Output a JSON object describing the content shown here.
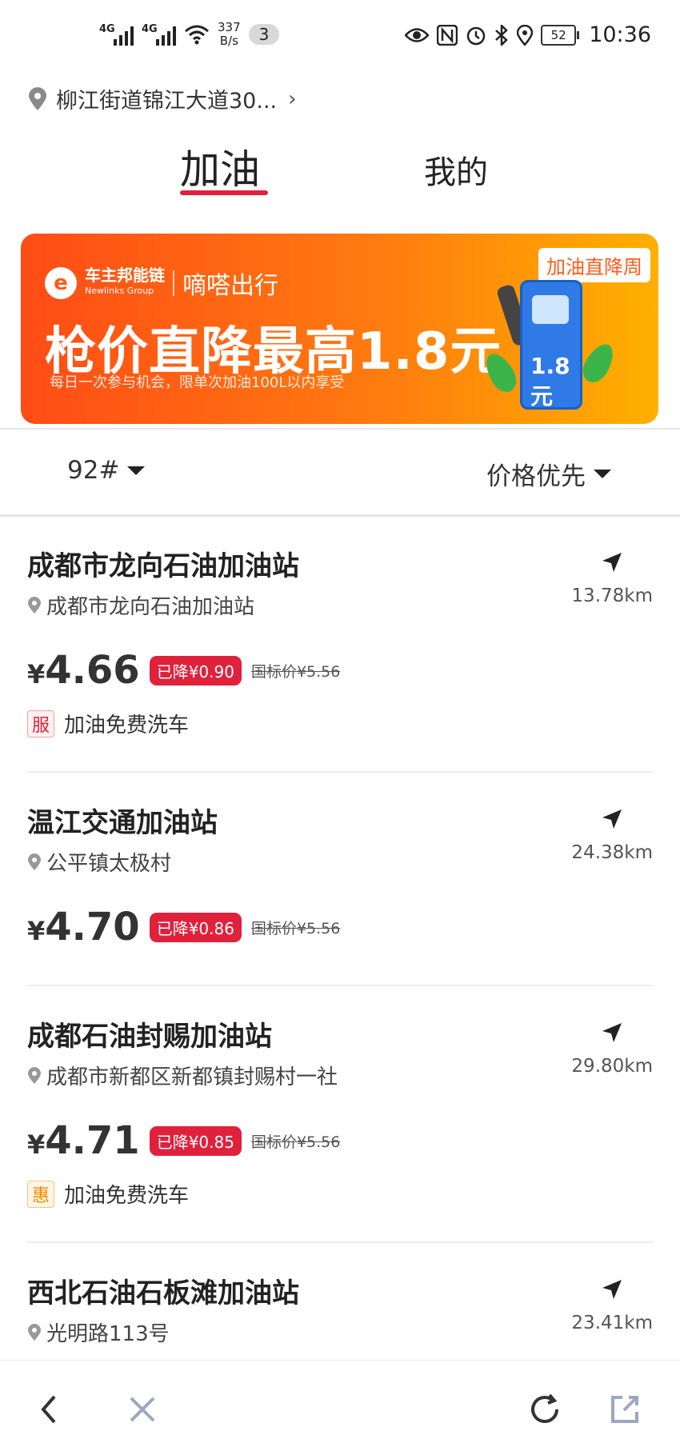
{
  "status_bar": {
    "net1": "4G",
    "net2": "4G",
    "speed": "337",
    "speed_unit": "B/s",
    "notif_count": "3",
    "battery": "52",
    "time": "10:36"
  },
  "location": {
    "text": "柳江街道锦江大道30...",
    "chevron": "›"
  },
  "tabs": {
    "fuel": "加油",
    "mine": "我的"
  },
  "banner": {
    "brand_logo": "e",
    "brand_cn": "车主邦能链",
    "brand_en": "Newlinks Group",
    "partner": "嘀嗒出行",
    "headline": "枪价直降最高1.8元",
    "subtitle": "每日一次参与机会，限单次加油100L以内享受",
    "tag": "加油直降周",
    "pump_price": "1.8元"
  },
  "filters": {
    "fuel_type": "92#",
    "sort": "价格优先"
  },
  "stations": [
    {
      "name": "成都市龙向石油加油站",
      "address": "成都市龙向石油加油站",
      "distance": "13.78km",
      "price": "4.66",
      "drop": "已降¥0.90",
      "standard": "国标价¥5.56",
      "perk_badge": "服",
      "perk_text": "加油免费洗车"
    },
    {
      "name": "温江交通加油站",
      "address": "公平镇太极村",
      "distance": "24.38km",
      "price": "4.70",
      "drop": "已降¥0.86",
      "standard": "国标价¥5.56"
    },
    {
      "name": "成都石油封赐加油站",
      "address": "成都市新都区新都镇封赐村一社",
      "distance": "29.80km",
      "price": "4.71",
      "drop": "已降¥0.85",
      "standard": "国标价¥5.56",
      "perk_badge": "惠",
      "perk_text": "加油免费洗车"
    },
    {
      "name": "西北石油石板滩加油站",
      "address": "光明路113号",
      "distance": "23.41km"
    }
  ],
  "currency": "¥",
  "colors": {
    "accent": "#e0213c",
    "banner_start": "#ff4c16",
    "banner_end": "#ffb000"
  }
}
